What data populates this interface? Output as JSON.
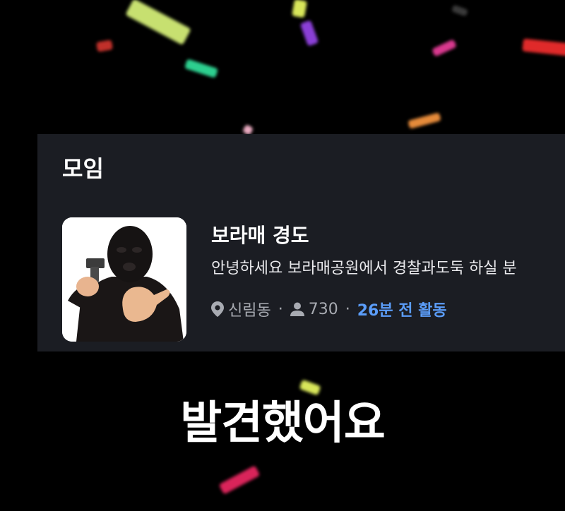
{
  "section_title": "모임",
  "group": {
    "name": "보라매 경도",
    "description": "안녕하세요 보라매공원에서 경찰과도둑 하실 분",
    "location_icon": "map-pin-icon",
    "location": "신림동",
    "members_icon": "person-icon",
    "member_count": "730",
    "activity": "26분 전 활동",
    "separator": "·"
  },
  "caption": "발견했어요",
  "colors": {
    "background": "#000000",
    "card": "#1b1d23",
    "accent_blue": "#5b9df9",
    "meta_gray": "#a8abb2"
  }
}
